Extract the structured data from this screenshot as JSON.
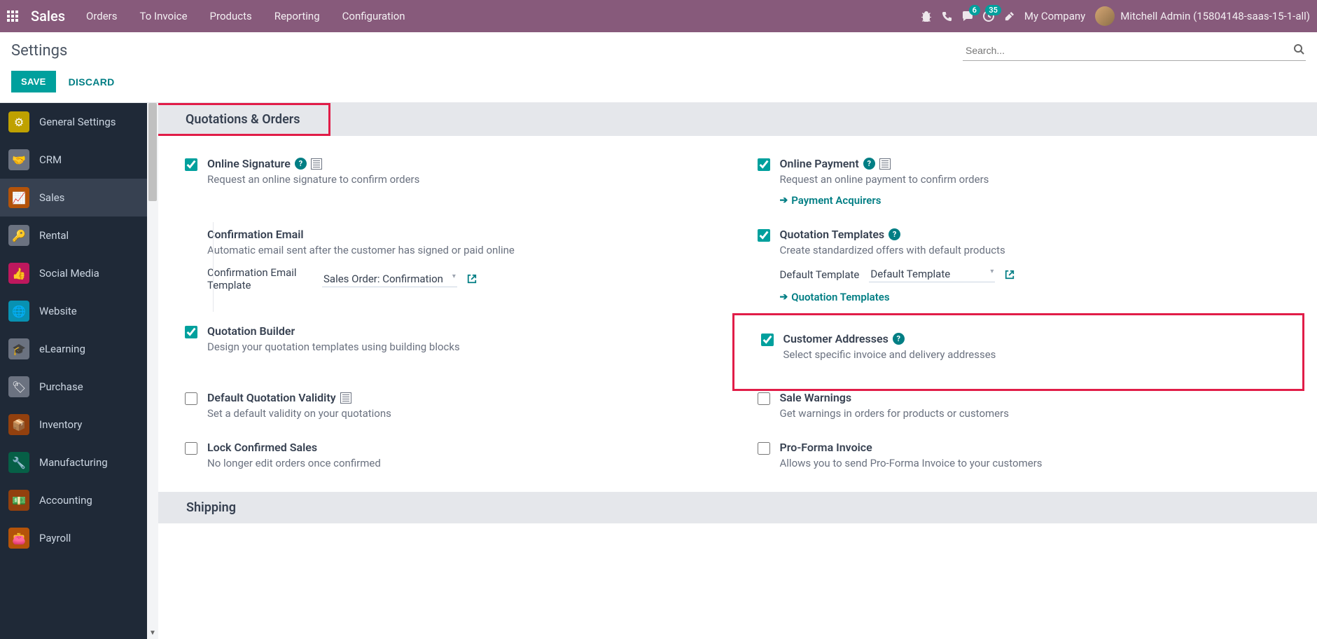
{
  "navbar": {
    "brand": "Sales",
    "links": [
      "Orders",
      "To Invoice",
      "Products",
      "Reporting",
      "Configuration"
    ],
    "messages_badge": "6",
    "activities_badge": "35",
    "company": "My Company",
    "user": "Mitchell Admin (15804148-saas-15-1-all)"
  },
  "control_panel": {
    "title": "Settings",
    "search_placeholder": "Search...",
    "save": "SAVE",
    "discard": "DISCARD"
  },
  "sidebar": {
    "items": [
      {
        "label": "General Settings",
        "bg": "#bfa100"
      },
      {
        "label": "CRM",
        "bg": "#6b7280"
      },
      {
        "label": "Sales",
        "bg": "#b45309"
      },
      {
        "label": "Rental",
        "bg": "#6b7280"
      },
      {
        "label": "Social Media",
        "bg": "#be185d"
      },
      {
        "label": "Website",
        "bg": "#0891b2"
      },
      {
        "label": "eLearning",
        "bg": "#6b7280"
      },
      {
        "label": "Purchase",
        "bg": "#6b7280"
      },
      {
        "label": "Inventory",
        "bg": "#92400e"
      },
      {
        "label": "Manufacturing",
        "bg": "#065f46"
      },
      {
        "label": "Accounting",
        "bg": "#92400e"
      },
      {
        "label": "Payroll",
        "bg": "#b45309"
      }
    ]
  },
  "sections": {
    "quotations": {
      "title": "Quotations & Orders",
      "online_signature": {
        "title": "Online Signature",
        "desc": "Request an online signature to confirm orders"
      },
      "online_payment": {
        "title": "Online Payment",
        "desc": "Request an online payment to confirm orders",
        "link": "Payment Acquirers"
      },
      "confirmation_email": {
        "title": "Confirmation Email",
        "desc": "Automatic email sent after the customer has signed or paid online",
        "field_label": "Confirmation Email Template",
        "field_value": "Sales Order: Confirmation"
      },
      "quotation_templates": {
        "title": "Quotation Templates",
        "desc": "Create standardized offers with default products",
        "field_label": "Default Template",
        "field_value": "Default Template",
        "link": "Quotation Templates"
      },
      "quotation_builder": {
        "title": "Quotation Builder",
        "desc": "Design your quotation templates using building blocks"
      },
      "customer_addresses": {
        "title": "Customer Addresses",
        "desc": "Select specific invoice and delivery addresses"
      },
      "default_validity": {
        "title": "Default Quotation Validity",
        "desc": "Set a default validity on your quotations"
      },
      "sale_warnings": {
        "title": "Sale Warnings",
        "desc": "Get warnings in orders for products or customers"
      },
      "lock_confirmed": {
        "title": "Lock Confirmed Sales",
        "desc": "No longer edit orders once confirmed"
      },
      "proforma": {
        "title": "Pro-Forma Invoice",
        "desc": "Allows you to send Pro-Forma Invoice to your customers"
      }
    },
    "shipping": {
      "title": "Shipping"
    }
  }
}
